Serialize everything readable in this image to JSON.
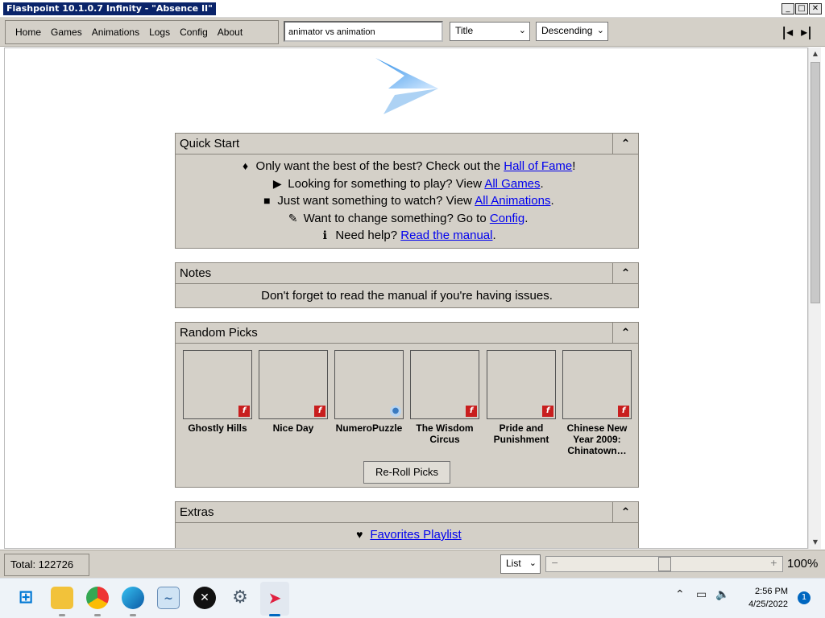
{
  "window": {
    "title": "Flashpoint 10.1.0.7 Infinity - \"Absence II\""
  },
  "nav": [
    {
      "label": "Home"
    },
    {
      "label": "Games"
    },
    {
      "label": "Animations"
    },
    {
      "label": "Logs"
    },
    {
      "label": "Config"
    },
    {
      "label": "About"
    }
  ],
  "search": {
    "value": "animator vs animation"
  },
  "sort": {
    "field": "Title",
    "order": "Descending"
  },
  "quick_start": {
    "title": "Quick Start",
    "lines": [
      {
        "icon": "award-icon",
        "text": "Only want the best of the best? Check out the ",
        "link": "Hall of Fame",
        "tail": "!"
      },
      {
        "icon": "play-icon",
        "text": "Looking for something to play? View ",
        "link": "All Games",
        "tail": "."
      },
      {
        "icon": "video-icon",
        "text": "Just want something to watch? View ",
        "link": "All Animations",
        "tail": "."
      },
      {
        "icon": "wrench-icon",
        "text": "Want to change something? Go to ",
        "link": "Config",
        "tail": "."
      },
      {
        "icon": "info-icon",
        "text": "Need help? ",
        "link": "Read the manual",
        "tail": "."
      }
    ]
  },
  "notes": {
    "title": "Notes",
    "text": "Don't forget to read the manual if you're having issues."
  },
  "random_picks": {
    "title": "Random Picks",
    "items": [
      {
        "name": "Ghostly Hills",
        "platform": "flash-icon"
      },
      {
        "name": "Nice Day",
        "platform": "flash-icon"
      },
      {
        "name": "NumeroPuzzle",
        "platform": "html5-icon"
      },
      {
        "name": "The Wisdom Circus",
        "platform": "flash-icon"
      },
      {
        "name": "Pride and Punishment",
        "platform": "flash-icon"
      },
      {
        "name": "Chinese New Year 2009: Chinatown…",
        "platform": "flash-icon"
      }
    ],
    "reroll_label": "Re-Roll Picks"
  },
  "extras": {
    "title": "Extras",
    "favorites_link": "Favorites Playlist"
  },
  "status": {
    "total": "Total: 122726",
    "view_mode": "List",
    "zoom": "100%",
    "zoom_slider_fraction": 0.5
  },
  "taskbar": {
    "time": "2:56 PM",
    "date": "4/25/2022",
    "notifications": "1"
  }
}
